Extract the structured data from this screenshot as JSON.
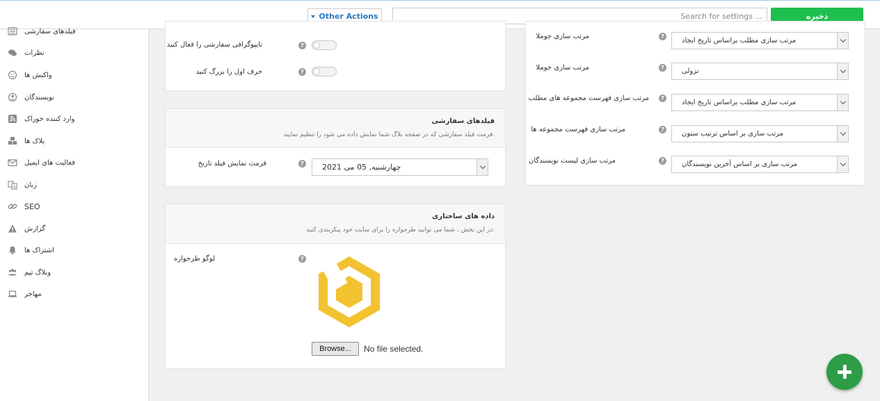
{
  "toolbar": {
    "save_label": "ذخیره",
    "search_placeholder": "Search for settings ...",
    "other_actions_label": "Other Actions"
  },
  "sidebar": {
    "items": [
      {
        "label": "فیلدهای سفارشی",
        "icon": "list-icon"
      },
      {
        "label": "نظرات",
        "icon": "comments-icon"
      },
      {
        "label": "واکنش ها",
        "icon": "smiley-icon"
      },
      {
        "label": "نویسندگان",
        "icon": "user-icon"
      },
      {
        "label": "وارد کننده خوراک",
        "icon": "rss-icon"
      },
      {
        "label": "بلاک ها",
        "icon": "cubes-icon"
      },
      {
        "label": "فعالیت های ایمیل",
        "icon": "envelope-icon"
      },
      {
        "label": "زبان",
        "icon": "language-icon"
      },
      {
        "label": "SEO",
        "icon": "link-icon"
      },
      {
        "label": "گزارش",
        "icon": "warning-icon"
      },
      {
        "label": "اشتراک ها",
        "icon": "bell-icon"
      },
      {
        "label": "وبلاگ تیم",
        "icon": "team-icon"
      },
      {
        "label": "مهاجر",
        "icon": "laptop-icon"
      }
    ]
  },
  "typography_card": {
    "rows": [
      {
        "label": "تایپوگرافی سفارشی را فعال کنید",
        "enabled": false
      },
      {
        "label": "حرف اول را بزرگ کنید",
        "enabled": false
      }
    ]
  },
  "custom_fields_card": {
    "title": "فیلدهای سفارشی",
    "description": "فرمت فیلد سفارشی که در صفحه بلاگ شما نمایش داده می شود را تنظیم نمایید.",
    "date_format_label": "فرمت نمایش فیلد تاریخ",
    "date_format_value": "چهارشنبه, 05 می 2021"
  },
  "structured_data_card": {
    "title": "داده های ساختاری",
    "description": "در این بخش ، شما می توانید طرحواره را برای سایت خود پیکربندی کنید.",
    "logo_label": "لوگو طرحواره",
    "browse_label": "Browse...",
    "file_status": "No file selected.",
    "logo_color": "#f2c230"
  },
  "sorting_card": {
    "rows": [
      {
        "label": "مرتب سازی جوملا",
        "value": "مرتب سازی مطلب براساس تاریخ ایجاد"
      },
      {
        "label": "مرتب سازی جوملا",
        "value": "نزولی"
      },
      {
        "label": "مرتب سازی فهرست مجموعه های مطلب",
        "value": "مرتب سازی مطلب براساس تاریخ ایجاد"
      },
      {
        "label": "مرتب سازی فهرست مجموعه ها",
        "value": "مرتب سازی بر اساس ترتیب ستون"
      },
      {
        "label": "مرتب سازی لیست نویسندگان",
        "value": "مرتب سازی بر اساس آخرین نویسندگان"
      }
    ]
  },
  "help_glyph": "?",
  "colors": {
    "save_green": "#1fbf4f",
    "fab_green": "#2e9d45",
    "link_blue": "#2b79c2"
  }
}
